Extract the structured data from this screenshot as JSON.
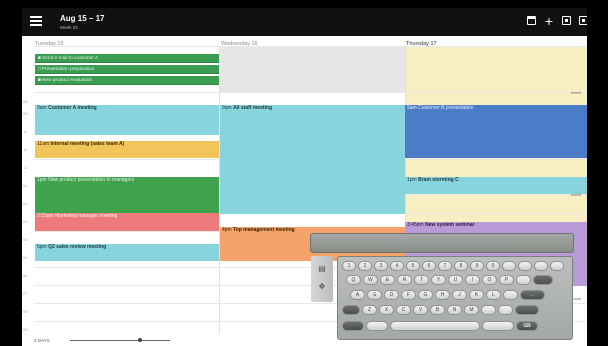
{
  "header": {
    "title": "Aug 15 – 17",
    "subtitle": "Week 33"
  },
  "days": [
    {
      "label": "Tuesday 15"
    },
    {
      "label": "Wednesday 16"
    },
    {
      "label": "Thursday 17"
    }
  ],
  "hours": [
    "08",
    "09",
    "10",
    "11",
    "12",
    "01",
    "02",
    "03",
    "04",
    "05",
    "06",
    "07",
    "08",
    "09",
    "10"
  ],
  "tasks": [
    "Send e-mail to customer A",
    "Presentation preparation",
    "New product evaluation"
  ],
  "events": {
    "customer_a": {
      "time": "9am",
      "title": "Customer A meeting"
    },
    "all_staff": {
      "time": "9am",
      "title": "All staff meeting"
    },
    "customer_b": {
      "time": "9am",
      "title": "Customer B presentation"
    },
    "internal": {
      "time": "11am",
      "title": "Internal meeting (sales team A)"
    },
    "new_product": {
      "time": "1pm",
      "title": "New product presentation to managers"
    },
    "brainstorm": {
      "time": "1pm",
      "title": "Brain storming C"
    },
    "marketing": {
      "time": "2:15pm",
      "title": "Marketing manager meeting"
    },
    "new_system": {
      "time": "3:45pm",
      "title": "New system seminar"
    },
    "top_mgmt": {
      "time": "4pm",
      "title": "Top management meeting"
    },
    "sales_review": {
      "time": "5pm",
      "title": "Q2 sales review meeting"
    }
  },
  "side_labels": [
    "meeti",
    "meeti",
    "Local"
  ],
  "bottom": {
    "zoom_label": "3 DAYS",
    "zoom_value": 0.7
  },
  "keyboard": {
    "row1": [
      "1",
      "2",
      "3",
      "4",
      "5",
      "6",
      "7",
      "8",
      "9",
      "0",
      "",
      "",
      "",
      ""
    ],
    "row2": [
      "Q",
      "W",
      "E",
      "R",
      "T",
      "Y",
      "U",
      "I",
      "O",
      "P",
      "",
      ""
    ],
    "row3": [
      "A",
      "S",
      "D",
      "F",
      "G",
      "H",
      "J",
      "K",
      "L",
      "",
      "←"
    ],
    "row4": [
      "Z",
      "X",
      "C",
      "V",
      "B",
      "N",
      "M",
      "",
      ""
    ],
    "row5": [
      "",
      "",
      "",
      ""
    ]
  },
  "colors": {
    "green": "#3fa34d",
    "teal": "#7fd3de",
    "yellow": "#f2c55a",
    "blue": "#4a7cc7",
    "red": "#ee7b7b",
    "orange": "#f4a36a",
    "purple": "#b79ad6",
    "cream": "#f7eec2"
  }
}
